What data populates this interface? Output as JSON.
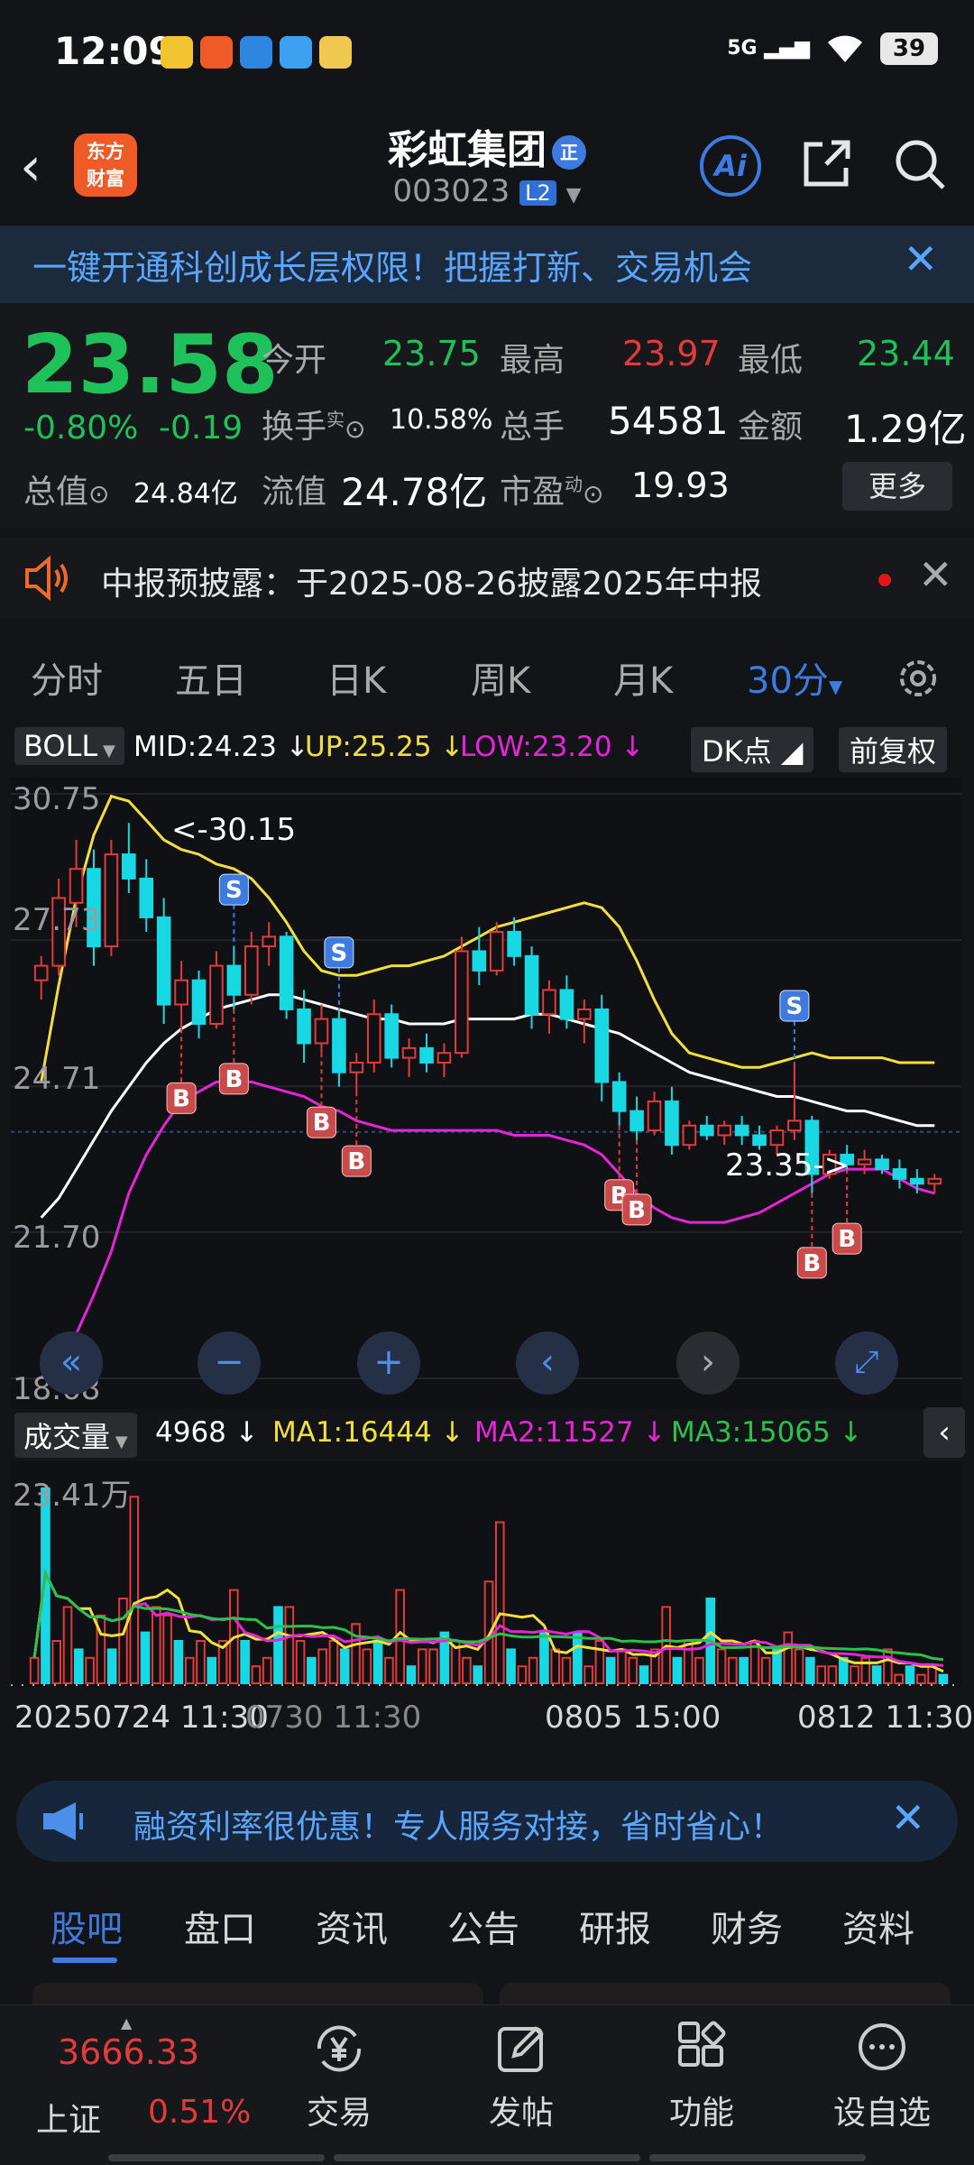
{
  "status_bar": {
    "time": "12:09",
    "network": "5G",
    "battery": "39"
  },
  "header": {
    "logo_line1": "东方",
    "logo_line2": "财富",
    "stock_name": "彩虹集团",
    "badge": "正",
    "stock_code": "003023",
    "level_badge": "L2",
    "ai_label": "Ai"
  },
  "promo_banner": {
    "text": "一键开通科创成长层权限！把握打新、交易机会"
  },
  "quote": {
    "price": "23.58",
    "change_pct": "-0.80%",
    "change": "-0.19",
    "items": [
      {
        "label": "今开",
        "value": "23.75"
      },
      {
        "label": "最高",
        "value": "23.97"
      },
      {
        "label": "最低",
        "value": "23.44"
      },
      {
        "label": "换手",
        "sup": "实",
        "value": "10.58%"
      },
      {
        "label": "总手",
        "value": "54581"
      },
      {
        "label": "金额",
        "value": "1.29亿"
      },
      {
        "label": "总值",
        "value": "24.84亿"
      },
      {
        "label": "流值",
        "value": "24.78亿"
      },
      {
        "label": "市盈",
        "sup": "动",
        "value": "19.93"
      }
    ],
    "more_button": "更多"
  },
  "notice": {
    "text": "中报预披露：于2025-08-26披露2025年中报"
  },
  "period_tabs": [
    "分时",
    "五日",
    "日K",
    "周K",
    "月K",
    "30分"
  ],
  "active_period": "30分",
  "indicator": {
    "name": "BOLL",
    "mid": "MID:24.23",
    "up": "UP:25.25",
    "low": "LOW:23.20",
    "dk_button": "DK点",
    "adjust_button": "前复权"
  },
  "colors": {
    "up": "#e33b3b",
    "down": "#18d8e4",
    "mid_line": "#ffffff",
    "up_line": "#f2e03a",
    "low_line": "#e624d8",
    "ma1": "#f2e03a",
    "ma2": "#e624d8",
    "ma3": "#29c24b",
    "accent": "#3d7be0"
  },
  "chart_data": {
    "type": "candlestick",
    "y_ticks": [
      "30.75",
      "27.73",
      "24.71",
      "21.70",
      "18.68"
    ],
    "ylim": [
      18.68,
      30.75
    ],
    "annotations": [
      "<-30.15",
      "23.35->"
    ],
    "signals": [
      "S",
      "S",
      "S",
      "B",
      "B",
      "B",
      "B",
      "B",
      "B",
      "B",
      "B"
    ],
    "candles": [
      [
        26.9,
        27.4,
        26.5,
        27.2
      ],
      [
        27.2,
        29.0,
        27.0,
        28.6
      ],
      [
        28.5,
        29.8,
        28.0,
        29.2
      ],
      [
        29.2,
        29.6,
        27.2,
        27.6
      ],
      [
        27.6,
        29.8,
        27.4,
        29.5
      ],
      [
        29.5,
        30.15,
        28.7,
        29.0
      ],
      [
        29.0,
        29.4,
        27.9,
        28.2
      ],
      [
        28.2,
        28.6,
        26.0,
        26.4
      ],
      [
        26.4,
        27.3,
        25.9,
        26.9
      ],
      [
        26.9,
        27.1,
        25.7,
        26.0
      ],
      [
        26.0,
        27.5,
        25.9,
        27.2
      ],
      [
        27.2,
        27.6,
        26.3,
        26.6
      ],
      [
        26.6,
        27.9,
        26.4,
        27.6
      ],
      [
        27.6,
        28.1,
        27.2,
        27.8
      ],
      [
        27.8,
        27.9,
        26.1,
        26.3
      ],
      [
        26.3,
        26.7,
        25.2,
        25.6
      ],
      [
        25.6,
        26.4,
        25.4,
        26.1
      ],
      [
        26.1,
        26.3,
        24.7,
        25.0
      ],
      [
        25.0,
        25.4,
        24.6,
        25.2
      ],
      [
        25.2,
        26.5,
        25.0,
        26.2
      ],
      [
        26.2,
        26.4,
        25.1,
        25.3
      ],
      [
        25.3,
        25.7,
        24.9,
        25.5
      ],
      [
        25.5,
        25.8,
        25.0,
        25.2
      ],
      [
        25.2,
        25.6,
        24.9,
        25.4
      ],
      [
        25.4,
        27.8,
        25.3,
        27.5
      ],
      [
        27.5,
        28.0,
        26.8,
        27.1
      ],
      [
        27.1,
        28.1,
        27.0,
        27.9
      ],
      [
        27.9,
        28.2,
        27.2,
        27.4
      ],
      [
        27.4,
        27.6,
        25.9,
        26.2
      ],
      [
        26.2,
        26.9,
        25.8,
        26.7
      ],
      [
        26.7,
        27.0,
        25.9,
        26.1
      ],
      [
        26.1,
        26.5,
        25.6,
        26.3
      ],
      [
        26.3,
        26.6,
        24.4,
        24.8
      ],
      [
        24.8,
        25.0,
        23.9,
        24.2
      ],
      [
        24.2,
        24.5,
        23.6,
        23.8
      ],
      [
        23.8,
        24.6,
        23.7,
        24.4
      ],
      [
        24.4,
        24.7,
        23.3,
        23.5
      ],
      [
        23.5,
        24.0,
        23.4,
        23.9
      ],
      [
        23.9,
        24.1,
        23.6,
        23.7
      ],
      [
        23.7,
        24.0,
        23.5,
        23.9
      ],
      [
        23.9,
        24.1,
        23.5,
        23.7
      ],
      [
        23.7,
        23.9,
        23.4,
        23.5
      ],
      [
        23.5,
        23.9,
        23.3,
        23.8
      ],
      [
        23.8,
        25.2,
        23.6,
        24.0
      ],
      [
        24.0,
        24.1,
        22.5,
        22.9
      ],
      [
        22.9,
        23.4,
        22.8,
        23.3
      ],
      [
        23.3,
        23.5,
        23.0,
        23.1
      ],
      [
        23.1,
        23.4,
        22.9,
        23.2
      ],
      [
        23.2,
        23.3,
        22.9,
        23.0
      ],
      [
        23.0,
        23.2,
        22.6,
        22.8
      ],
      [
        22.8,
        23.0,
        22.5,
        22.7
      ],
      [
        22.7,
        22.9,
        22.5,
        22.8
      ]
    ],
    "mid_line": [
      22.0,
      22.4,
      23.0,
      23.6,
      24.2,
      24.7,
      25.2,
      25.6,
      25.9,
      26.1,
      26.3,
      26.4,
      26.5,
      26.6,
      26.6,
      26.5,
      26.4,
      26.3,
      26.2,
      26.1,
      26.1,
      26.0,
      26.0,
      26.0,
      26.1,
      26.1,
      26.1,
      26.1,
      26.2,
      26.2,
      26.1,
      26.0,
      25.9,
      25.8,
      25.6,
      25.4,
      25.2,
      25.0,
      24.9,
      24.8,
      24.7,
      24.6,
      24.5,
      24.5,
      24.4,
      24.3,
      24.2,
      24.2,
      24.1,
      24.0,
      23.9,
      23.9
    ],
    "up_line": [
      24.8,
      26.8,
      28.6,
      29.9,
      30.7,
      30.6,
      30.2,
      29.8,
      29.6,
      29.5,
      29.3,
      29.2,
      29.0,
      28.6,
      28.1,
      27.5,
      27.1,
      27.0,
      27.0,
      27.1,
      27.2,
      27.2,
      27.3,
      27.4,
      27.6,
      27.8,
      28.0,
      28.1,
      28.2,
      28.3,
      28.4,
      28.5,
      28.4,
      28.0,
      27.3,
      26.5,
      25.8,
      25.4,
      25.3,
      25.2,
      25.1,
      25.1,
      25.2,
      25.3,
      25.4,
      25.3,
      25.3,
      25.3,
      25.3,
      25.2,
      25.2,
      25.2
    ],
    "low_line": [
      18.7,
      19.0,
      19.6,
      20.4,
      21.3,
      22.5,
      23.3,
      23.9,
      24.4,
      24.6,
      24.8,
      24.8,
      24.8,
      24.7,
      24.6,
      24.5,
      24.3,
      24.2,
      24.0,
      23.9,
      23.8,
      23.8,
      23.8,
      23.8,
      23.8,
      23.8,
      23.8,
      23.7,
      23.7,
      23.7,
      23.6,
      23.5,
      23.3,
      22.9,
      22.5,
      22.2,
      22.0,
      21.9,
      21.9,
      21.9,
      22.0,
      22.1,
      22.3,
      22.5,
      22.7,
      22.9,
      23.0,
      23.0,
      23.0,
      22.8,
      22.6,
      22.5
    ]
  },
  "volume": {
    "label": "成交量",
    "current": "4968",
    "ma1": "MA1:16444",
    "ma2": "MA2:11527",
    "ma3": "MA3:15065",
    "y_max_label": "23.41万",
    "x_labels": [
      "20250724 11:30",
      "0730 11:30",
      "0805 15:00",
      "0812 11:30"
    ],
    "bars": [
      0.3,
      2.3,
      0.5,
      0.9,
      0.4,
      0.3,
      0.8,
      0.4,
      1.0,
      2.2,
      0.6,
      0.9,
      0.8,
      0.5,
      0.3,
      0.5,
      0.3,
      0.5,
      1.1,
      0.5,
      0.2,
      0.3,
      0.9,
      0.9,
      0.5,
      0.3,
      0.4,
      0.5,
      0.4,
      0.7,
      0.4,
      0.5,
      0.3,
      1.1,
      0.2,
      0.4,
      0.4,
      0.6,
      0.5,
      0.3,
      0.2,
      1.2,
      1.9,
      0.4,
      0.2,
      0.3,
      0.6,
      0.4,
      0.3,
      0.6,
      0.2,
      0.5,
      0.3,
      0.4,
      0.3,
      0.2,
      0.4,
      0.9,
      0.3,
      0.5,
      0.3,
      1.0,
      0.4,
      0.3,
      0.3,
      0.5,
      0.3,
      0.4,
      0.6,
      0.4,
      0.3,
      0.2,
      0.2,
      0.3,
      0.2,
      0.3,
      0.2,
      0.4,
      0.1,
      0.2,
      0.1,
      0.2,
      0.1
    ]
  },
  "ad_banner": {
    "text": "融资利率很优惠！专人服务对接，省时省心！"
  },
  "content_tabs": [
    "股吧",
    "盘口",
    "资讯",
    "公告",
    "研报",
    "财务",
    "资料"
  ],
  "bottom_nav": {
    "index_value": "3666.33",
    "index_name": "上证",
    "index_change": "0.51%",
    "items": [
      "交易",
      "发帖",
      "功能",
      "设自选"
    ]
  }
}
